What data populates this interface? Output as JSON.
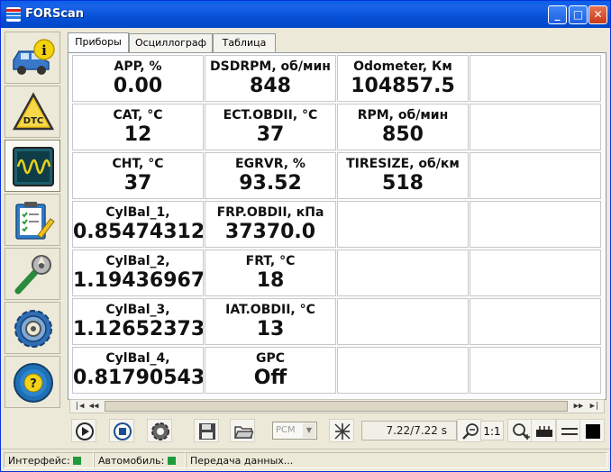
{
  "window": {
    "title": "FORScan",
    "minimize": "_",
    "maximize": "□",
    "close": "✕"
  },
  "sidebar": {
    "items": [
      {
        "name": "vehicle-info-icon",
        "active": false
      },
      {
        "name": "dtc-icon",
        "label": "DTC",
        "active": false
      },
      {
        "name": "oscilloscope-icon",
        "active": true
      },
      {
        "name": "checklist-icon",
        "active": false
      },
      {
        "name": "service-tools-icon",
        "active": false
      },
      {
        "name": "settings-gear-icon",
        "active": false
      },
      {
        "name": "help-icon",
        "label": "?",
        "active": false
      }
    ]
  },
  "tabs": [
    {
      "label": "Приборы",
      "active": true
    },
    {
      "label": "Осциллограф",
      "active": false
    },
    {
      "label": "Таблица",
      "active": false
    }
  ],
  "gauges": [
    [
      {
        "label": "APP, %",
        "value": "0.00"
      },
      {
        "label": "DSDRPM, об/мин",
        "value": "848"
      },
      {
        "label": "Odometer, Км",
        "value": "104857.5"
      },
      {
        "label": "",
        "value": ""
      }
    ],
    [
      {
        "label": "CAT, °C",
        "value": "12"
      },
      {
        "label": "ECT.OBDII, °C",
        "value": "37"
      },
      {
        "label": "RPM, об/мин",
        "value": "850"
      },
      {
        "label": "",
        "value": ""
      }
    ],
    [
      {
        "label": "CHT, °C",
        "value": "37"
      },
      {
        "label": "EGRVR, %",
        "value": "93.52"
      },
      {
        "label": "TIRESIZE, об/км",
        "value": "518"
      },
      {
        "label": "",
        "value": ""
      }
    ],
    [
      {
        "label": "CylBal_1,",
        "value": "0.85474312"
      },
      {
        "label": "FRP.OBDII, кПа",
        "value": "37370.0"
      },
      {
        "label": "",
        "value": ""
      },
      {
        "label": "",
        "value": ""
      }
    ],
    [
      {
        "label": "CylBal_2,",
        "value": "1.19436967"
      },
      {
        "label": "FRT, °C",
        "value": "18"
      },
      {
        "label": "",
        "value": ""
      },
      {
        "label": "",
        "value": ""
      }
    ],
    [
      {
        "label": "CylBal_3,",
        "value": "1.12652373"
      },
      {
        "label": "IAT.OBDII, °C",
        "value": "13"
      },
      {
        "label": "",
        "value": ""
      },
      {
        "label": "",
        "value": ""
      }
    ],
    [
      {
        "label": "CylBal_4,",
        "value": "0.81790543"
      },
      {
        "label": "GPC",
        "value": "Off"
      },
      {
        "label": "",
        "value": ""
      },
      {
        "label": "",
        "value": ""
      }
    ]
  ],
  "scrollbar": {
    "first": "|◀",
    "prev": "◀◀",
    "next": "▶▶",
    "last": "▶|"
  },
  "toolbar": {
    "combo_value": "PCM",
    "combo_arrow": "▼",
    "time": "7.22/7.22 s",
    "zoom_ratio": "1:1"
  },
  "status": {
    "interface_label": "Интерфейс:",
    "vehicle_label": "Автомобиль:",
    "message": "Передача данных...",
    "led_color": "#1f9a3c"
  }
}
